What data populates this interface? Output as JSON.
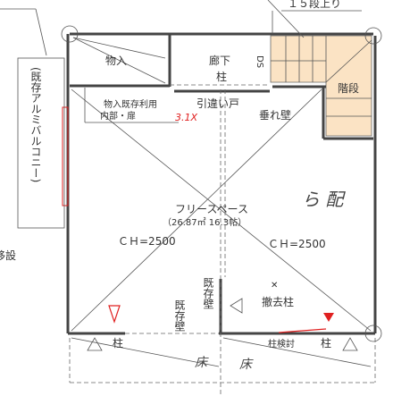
{
  "labels": {
    "stairs_up": "１５段上り",
    "storage": "物入",
    "corridor": "廊下",
    "column_corridor": "柱",
    "ds": "DS",
    "stairs": "階段",
    "storage_note_1": "物入既存利用",
    "storage_note_2": "内部・扉",
    "sliding_door": "引違い戸",
    "hanging_wall": "垂れ壁",
    "free_space": "フリースペース",
    "area": "（26.87㎡ 16.3帖）",
    "ch_left": "ＣＨ=2500",
    "ch_right": "ＣＨ=2500",
    "existing_wall_1": "既存壁",
    "existing_wall_2": "既存壁",
    "removed_column": "撤去柱",
    "column_left": "柱",
    "column_check": "柱検討",
    "column_right": "柱",
    "balcony": "(既存アルミバルコニー)",
    "relocate": "移設"
  },
  "handwritten": {
    "note_red": "3.1X",
    "note_right": "ら 配",
    "note_bottom_1": "床",
    "note_bottom_2": "床"
  },
  "colors": {
    "stair_fill": "#fbe3c4",
    "red_ink": "#e02020"
  }
}
